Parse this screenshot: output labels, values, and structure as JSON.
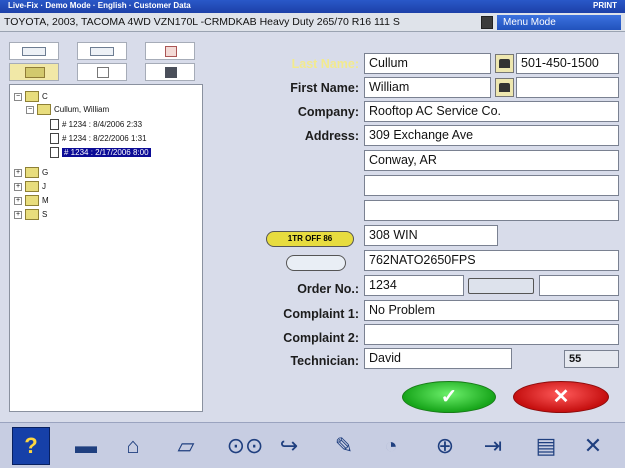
{
  "window": {
    "title": "Live-Fix · Demo Mode · English · Customer Data",
    "right_text": "PRINT"
  },
  "vehicle": {
    "description": "TOYOTA, 2003, TACOMA 4WD VZN170L -CRMDKAB Heavy Duty 265/70 R16 111 S"
  },
  "menu_mode": {
    "label": "Menu Mode"
  },
  "left_panel": {
    "tree": [
      {
        "label": "C",
        "level": 0,
        "type": "folder",
        "expanded": true
      },
      {
        "label": "Cullum, William",
        "level": 1,
        "type": "folder",
        "expanded": true
      },
      {
        "label": "# 1234 : 8/4/2006 2:33",
        "level": 2,
        "type": "doc"
      },
      {
        "label": "# 1234 : 8/22/2006 1:31",
        "level": 2,
        "type": "doc"
      },
      {
        "label": "# 1234 : 2/17/2006 8:00",
        "level": 2,
        "type": "doc",
        "selected": true
      },
      {
        "label": "G",
        "level": 0,
        "type": "folder",
        "expanded": false
      },
      {
        "label": "J",
        "level": 0,
        "type": "folder",
        "expanded": false
      },
      {
        "label": "M",
        "level": 0,
        "type": "folder",
        "expanded": false
      },
      {
        "label": "S",
        "level": 0,
        "type": "folder",
        "expanded": false
      }
    ]
  },
  "form": {
    "last_name": {
      "label": "Last Name:",
      "value": "Cullum"
    },
    "phone1": {
      "value": "501-450-1500"
    },
    "first_name": {
      "label": "First Name:",
      "value": "William"
    },
    "phone2": {
      "value": ""
    },
    "company": {
      "label": "Company:",
      "value": "Rooftop AC Service Co."
    },
    "address": {
      "label": "Address:",
      "lines": [
        "309 Exchange Ave",
        "Conway, AR",
        "",
        ""
      ]
    },
    "vin_badge": {
      "label": "1TR OFF 86"
    },
    "license": {
      "value": "308 WIN"
    },
    "vin": {
      "value": "762NATO2650FPS"
    },
    "order_no": {
      "label": "Order No.:",
      "value": "1234",
      "extra": ""
    },
    "complaint1": {
      "label": "Complaint 1:",
      "value": "No Problem"
    },
    "complaint2": {
      "label": "Complaint 2:",
      "value": ""
    },
    "technician": {
      "label": "Technician:",
      "value": "David",
      "count": "55"
    }
  },
  "actions": {
    "ok_label": "✓",
    "cancel_label": "✕"
  }
}
